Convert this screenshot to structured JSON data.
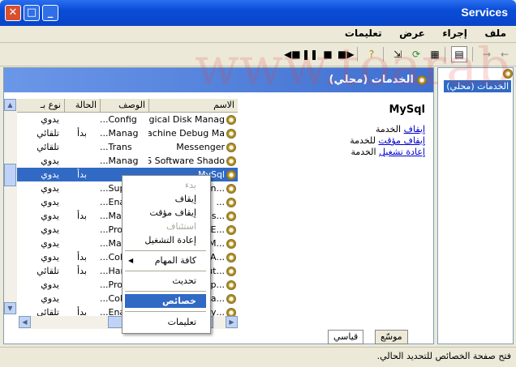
{
  "window": {
    "title": "Services"
  },
  "menu": [
    "ملف",
    "إجراء",
    "عرض",
    "تعليمات"
  ],
  "tree": {
    "node": "الخدمات (محلي)"
  },
  "pane": {
    "header": "الخدمات (محلي)"
  },
  "details": {
    "service_name": "MySql",
    "links": [
      {
        "link": "إيقاف",
        "rest": " الخدمة"
      },
      {
        "link": "إيقاف مؤقت",
        "rest": " للخدمة"
      },
      {
        "link": "إعادة تشغيل",
        "rest": " الخدمة"
      }
    ]
  },
  "columns": {
    "name": "الاسم",
    "desc": "الوصف",
    "status": "الحالة",
    "type": "نوع بـ"
  },
  "rows": [
    {
      "name": "Logical Disk Manag...",
      "desc": "Config...",
      "status": "",
      "type": "يدوي"
    },
    {
      "name": "Machine Debug Ma...",
      "desc": "Manag...",
      "status": "بدأ",
      "type": "تلقائي"
    },
    {
      "name": "Messenger",
      "desc": "Trans...",
      "status": "",
      "type": "تلقائي"
    },
    {
      "name": "MS Software Shado...",
      "desc": "Manag...",
      "status": "",
      "type": "يدوي"
    },
    {
      "name": "MySql",
      "desc": "",
      "status": "بدأ",
      "type": "يدوي"
    },
    {
      "name": "...gon",
      "desc": "Supp...",
      "status": "",
      "type": "يدوي"
    },
    {
      "name": "...",
      "desc": "Enab...",
      "status": "",
      "type": "يدوي"
    },
    {
      "name": "...ons",
      "desc": "Mana...",
      "status": "بدأ",
      "type": "يدوي"
    },
    {
      "name": "...DE",
      "desc": "Prov...",
      "status": "",
      "type": "يدوي"
    },
    {
      "name": "...OM",
      "desc": "Mana...",
      "status": "",
      "type": "يدوي"
    },
    {
      "name": "...n A",
      "desc": "Colle...",
      "status": "بدأ",
      "type": "يدوي"
    },
    {
      "name": "...Aut",
      "desc": "Hand...",
      "status": "بدأ",
      "type": "تلقائي"
    },
    {
      "name": "...Sup",
      "desc": "Prov...",
      "status": "",
      "type": "يدوي"
    },
    {
      "name": "...s a",
      "desc": "Colle...",
      "status": "",
      "type": "يدوي"
    },
    {
      "name": "...Play",
      "desc": "Enab...",
      "status": "بدأ",
      "type": "تلقائي"
    }
  ],
  "context_menu": {
    "start": "بدء",
    "stop": "إيقاف",
    "pause": "إيقاف مؤقت",
    "resume": "استئناف",
    "restart": "إعادة التشغيل",
    "all_tasks": "كافة المهام",
    "refresh": "تحديث",
    "properties": "خصائص",
    "help": "تعليمات"
  },
  "tabs": {
    "extended": "موسّع",
    "standard": "قياسي"
  },
  "status_text": "فتح صفحة الخصائص للتحديد الحالي.",
  "watermark": "www.toarab.ws",
  "colors": {
    "titlebar": "#0a4cd8",
    "selection": "#316ac5",
    "header": "#3e6fd0"
  }
}
